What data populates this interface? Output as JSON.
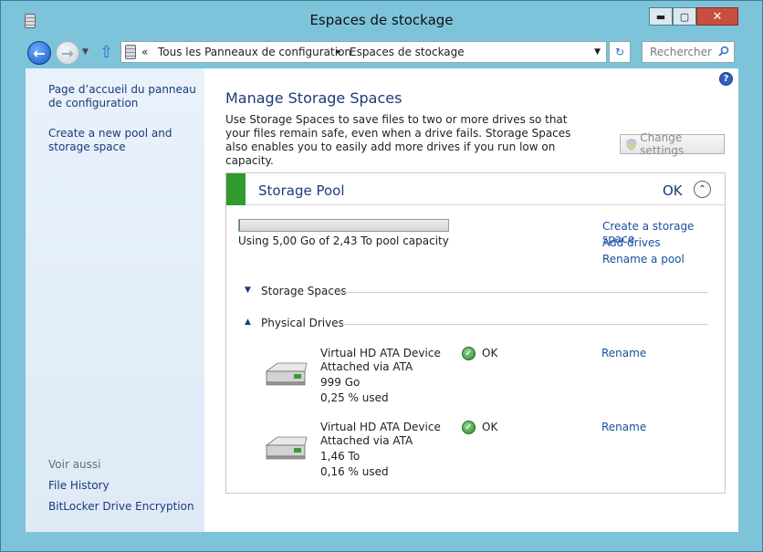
{
  "window": {
    "title": "Espaces de stockage",
    "buttons": {
      "minimize": "▬",
      "maximize": "▢",
      "close": "✕"
    }
  },
  "address": {
    "prefix": "«",
    "crumbs": [
      "Tous les Panneaux de configuration",
      "Espaces de stockage"
    ],
    "separator": "▸",
    "search_placeholder": "Rechercher"
  },
  "sidebar": {
    "home_link": "Page d’accueil du panneau de configuration",
    "create_link": "Create a new pool and storage space",
    "see_also": "Voir aussi",
    "file_history": "File History",
    "bitlocker": "BitLocker Drive Encryption"
  },
  "main": {
    "heading": "Manage Storage Spaces",
    "description": "Use Storage Spaces to save files to two or more drives so that your files remain safe, even when a drive fails. Storage Spaces also enables you to easily add more drives if you run low on capacity.",
    "change_settings": "Change settings",
    "pool": {
      "title": "Storage Pool",
      "status": "OK",
      "usage_text": "Using 5,00 Go of 2,43 To pool capacity",
      "usage_fraction": 0.002,
      "links": [
        "Create a storage space",
        "Add drives",
        "Rename a pool"
      ],
      "sections": {
        "spaces": "Storage Spaces",
        "physical": "Physical Drives"
      },
      "drives": [
        {
          "name": "Virtual HD ATA Device",
          "attached": "Attached via ATA",
          "size": "999 Go",
          "used": "0,25 % used",
          "status": "OK",
          "action": "Rename"
        },
        {
          "name": "Virtual HD ATA Device",
          "attached": "Attached via ATA",
          "size": "1,46 To",
          "used": "0,16 % used",
          "status": "OK",
          "action": "Rename"
        }
      ]
    }
  },
  "colors": {
    "accent_green": "#2f9a2f",
    "link_blue": "#1a4fa0",
    "heading_blue": "#1a3a7a",
    "frame": "#7dc3da"
  }
}
